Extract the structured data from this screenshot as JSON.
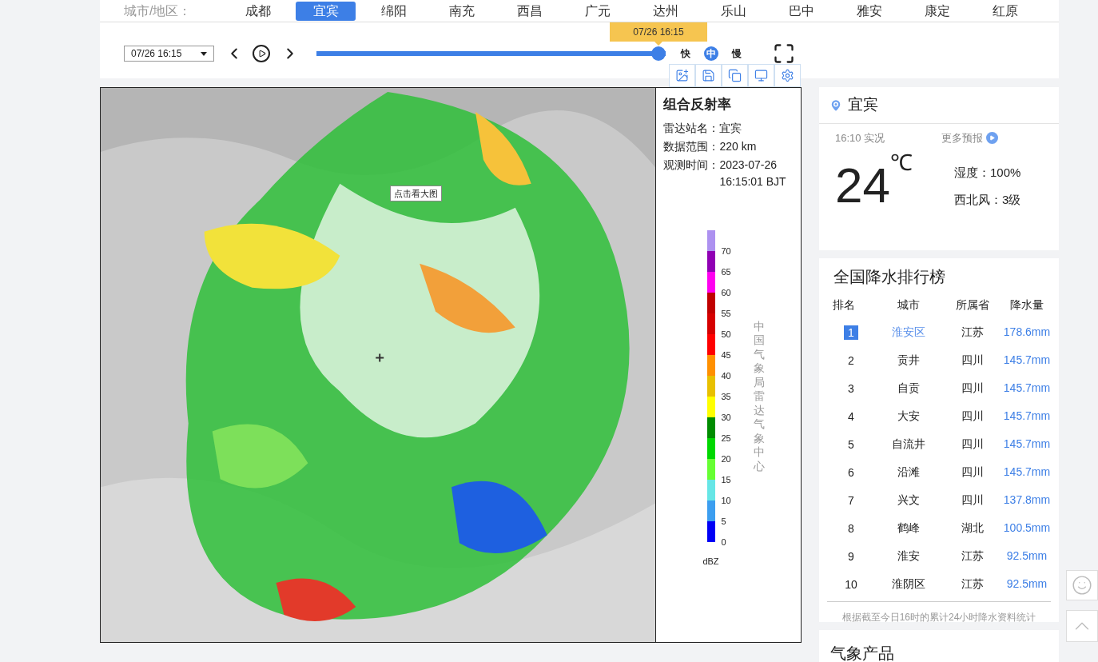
{
  "city_bar": {
    "label": "城市/地区：",
    "cities": [
      {
        "name": "成都",
        "selected": false
      },
      {
        "name": "宜宾",
        "selected": true
      },
      {
        "name": "绵阳",
        "selected": false
      },
      {
        "name": "南充",
        "selected": false
      },
      {
        "name": "西昌",
        "selected": false
      },
      {
        "name": "广元",
        "selected": false
      },
      {
        "name": "达州",
        "selected": false
      },
      {
        "name": "乐山",
        "selected": false
      },
      {
        "name": "巴中",
        "selected": false
      },
      {
        "name": "雅安",
        "selected": false
      },
      {
        "name": "康定",
        "selected": false
      },
      {
        "name": "红原",
        "selected": false
      }
    ]
  },
  "player": {
    "time_select": "07/26 16:15",
    "slider": {
      "level": 1,
      "tooltip": "07/26 16:15"
    },
    "speeds": [
      {
        "label": "快",
        "selected": false
      },
      {
        "label": "中",
        "selected": true
      },
      {
        "label": "慢",
        "selected": false
      }
    ]
  },
  "radar": {
    "map_tooltip": "点击看大图",
    "title": "组合反射率",
    "info": [
      {
        "label": "雷达站名：",
        "value": "宜宾"
      },
      {
        "label": "数据范围：",
        "value": "220 km"
      },
      {
        "label": "观测时间：",
        "value": "2023-07-26 16:15:01 BJT"
      }
    ],
    "legend": [
      {
        "label": "70",
        "color": "#ad91f0"
      },
      {
        "label": "65",
        "color": "#9000b4"
      },
      {
        "label": "60",
        "color": "#ff00f0"
      },
      {
        "label": "55",
        "color": "#c00000"
      },
      {
        "label": "50",
        "color": "#d60000"
      },
      {
        "label": "45",
        "color": "#ff0000"
      },
      {
        "label": "40",
        "color": "#ff9000"
      },
      {
        "label": "35",
        "color": "#e8c000"
      },
      {
        "label": "30",
        "color": "#ffff00"
      },
      {
        "label": "25",
        "color": "#008c00"
      },
      {
        "label": "20",
        "color": "#00d800"
      },
      {
        "label": "15",
        "color": "#66ff33"
      },
      {
        "label": "10",
        "color": "#66e6e6"
      },
      {
        "label": "5",
        "color": "#3c9ef0"
      },
      {
        "label": "0",
        "color": "#0000f6"
      }
    ],
    "unit": "dBZ",
    "credit": "中国气象局雷达气象中心"
  },
  "weather": {
    "city": "宜宾",
    "observed": "16:10 实况",
    "more": "更多预报",
    "temperature": "24",
    "unit": "℃",
    "humidity": "湿度：100%",
    "wind": "西北风：3级"
  },
  "ranking": {
    "title": "全国降水排行榜",
    "columns": [
      "排名",
      "城市",
      "所属省",
      "降水量"
    ],
    "rows": [
      {
        "rank": "1",
        "city": "淮安区",
        "province": "江苏",
        "amount": "178.6mm",
        "highlighted": true
      },
      {
        "rank": "2",
        "city": "贡井",
        "province": "四川",
        "amount": "145.7mm",
        "highlighted": false
      },
      {
        "rank": "3",
        "city": "自贡",
        "province": "四川",
        "amount": "145.7mm",
        "highlighted": false
      },
      {
        "rank": "4",
        "city": "大安",
        "province": "四川",
        "amount": "145.7mm",
        "highlighted": false
      },
      {
        "rank": "5",
        "city": "自流井",
        "province": "四川",
        "amount": "145.7mm",
        "highlighted": false
      },
      {
        "rank": "6",
        "city": "沿滩",
        "province": "四川",
        "amount": "145.7mm",
        "highlighted": false
      },
      {
        "rank": "7",
        "city": "兴文",
        "province": "四川",
        "amount": "137.8mm",
        "highlighted": false
      },
      {
        "rank": "8",
        "city": "鹤峰",
        "province": "湖北",
        "amount": "100.5mm",
        "highlighted": false
      },
      {
        "rank": "9",
        "city": "淮安",
        "province": "江苏",
        "amount": "92.5mm",
        "highlighted": false
      },
      {
        "rank": "10",
        "city": "淮阴区",
        "province": "江苏",
        "amount": "92.5mm",
        "highlighted": false
      }
    ],
    "note": "根据截至今日16时的累计24小时降水资料统计"
  },
  "products": {
    "title": "气象产品"
  }
}
